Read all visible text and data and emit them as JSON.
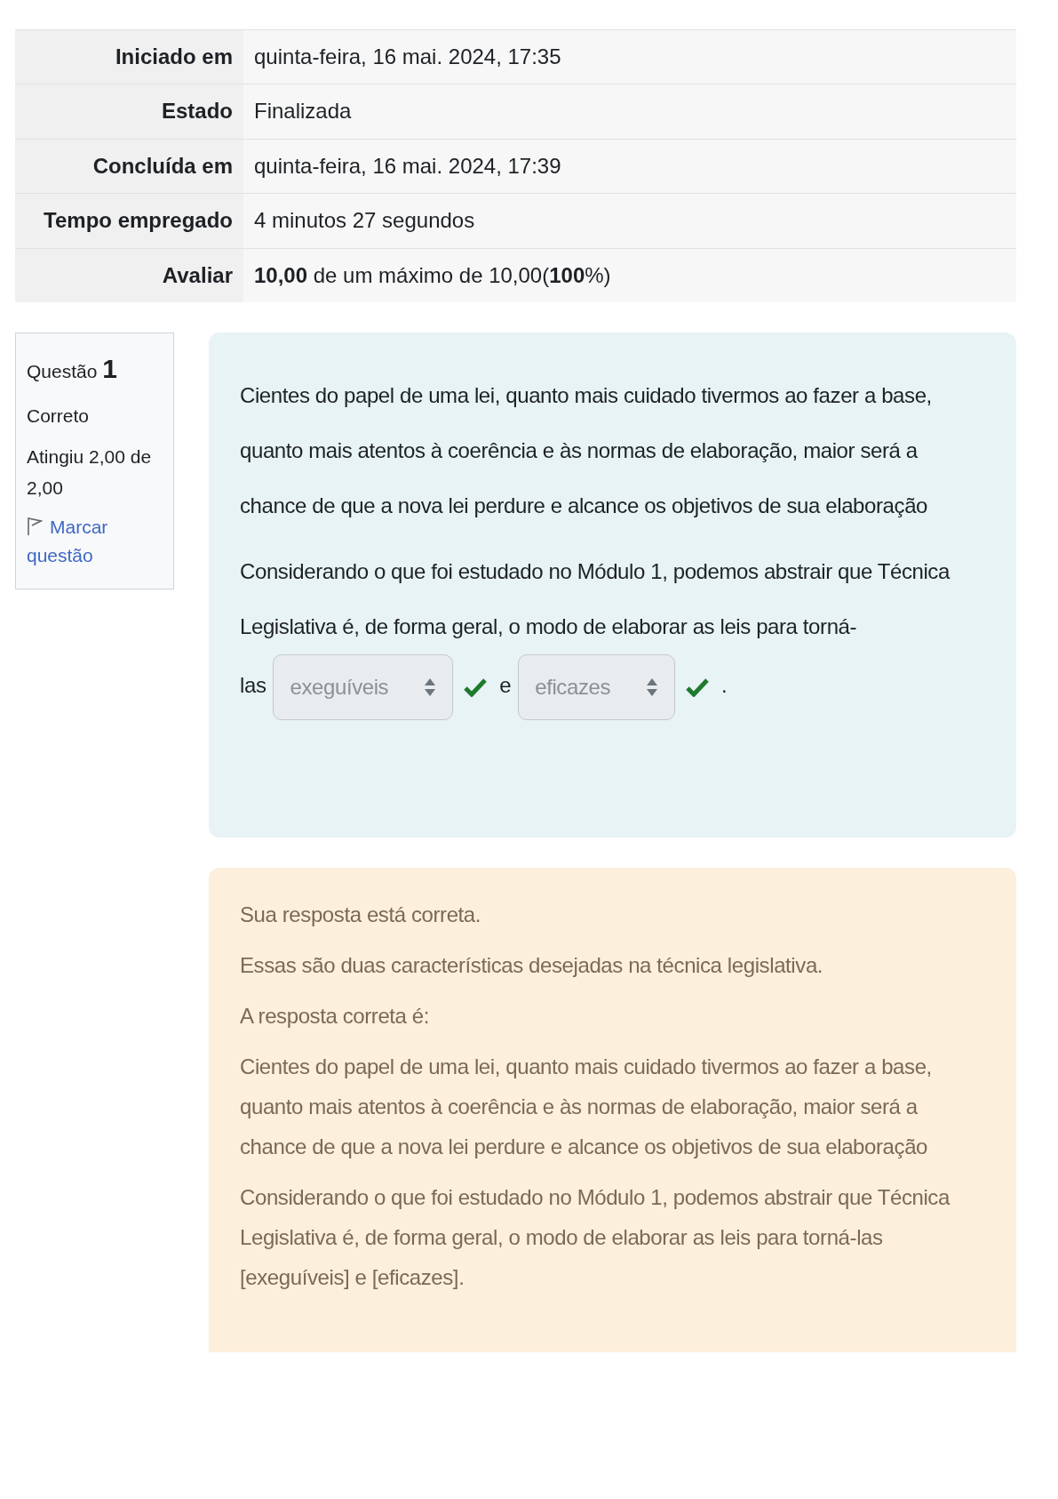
{
  "summary": {
    "rows": [
      {
        "label": "Iniciado em",
        "value": "quinta-feira, 16 mai. 2024, 17:35"
      },
      {
        "label": "Estado",
        "value": "Finalizada"
      },
      {
        "label": "Concluída em",
        "value": "quinta-feira, 16 mai. 2024, 17:39"
      },
      {
        "label": "Tempo empregado",
        "value": "4 minutos 27 segundos"
      },
      {
        "label": "Avaliar",
        "value": "**10,00** de um máximo de 10,00(**100**%)"
      }
    ]
  },
  "question_info": {
    "label": "Questão",
    "number": "1",
    "state": "Correto",
    "grade": "Atingiu 2,00 de 2,00",
    "flag_link": "Marcar questão"
  },
  "question": {
    "intro": "Cientes do papel de uma lei, quanto mais cuidado tivermos ao fazer a base, quanto mais atentos à coerência e às normas de elaboração, maior será a chance de que a nova lei perdure e alcance os objetivos de sua elaboração",
    "parts": [
      {
        "kind": "line",
        "text": "Considerando o que foi estudado no Módulo 1, podemos abstrair que Técnica Legislativa é, de forma geral, o modo de elaborar as leis para torná-"
      },
      {
        "kind": "text",
        "text": "las"
      },
      {
        "kind": "select",
        "value": "exeguíveis",
        "correct": true
      },
      {
        "kind": "text",
        "text": "e"
      },
      {
        "kind": "select",
        "value": "eficazes",
        "correct": true
      },
      {
        "kind": "text",
        "text": "."
      }
    ]
  },
  "feedback": {
    "paragraphs": [
      "Sua resposta está correta.",
      "Essas são duas características desejadas na técnica legislativa.",
      "A resposta correta é:",
      "Cientes do papel de uma lei, quanto mais cuidado tivermos ao fazer a base, quanto mais atentos à coerência e às normas de elaboração, maior será a chance de que a nova lei perdure e alcance os objetivos de sua elaboração",
      "Considerando o que foi estudado no Módulo 1, podemos abstrair que Técnica Legislativa é, de forma geral, o modo de elaborar as leis para torná-las [exeguíveis] e [eficazes]."
    ]
  }
}
